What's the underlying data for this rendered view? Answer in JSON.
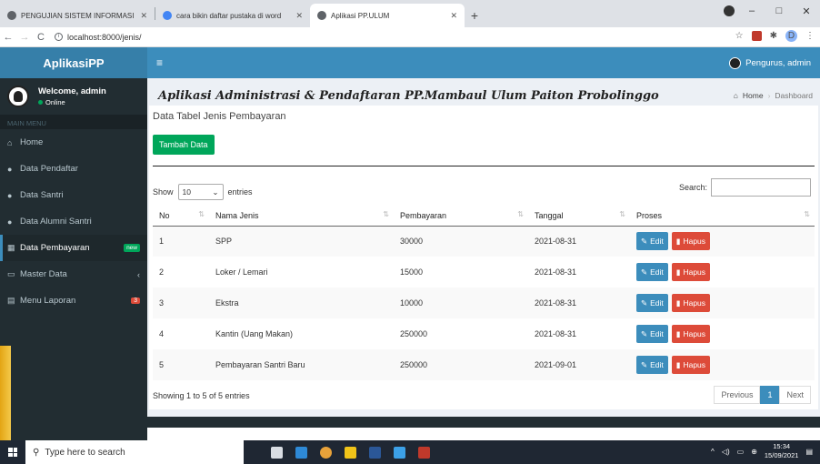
{
  "browser": {
    "tabs": [
      {
        "title": "PENGUJIAN SISTEM INFORMASI",
        "active": false
      },
      {
        "title": "cara bikin daftar pustaka di word",
        "active": false
      },
      {
        "title": "Aplikasi PP.ULUM",
        "active": true
      }
    ],
    "url": "localhost:8000/jenis/",
    "new_tab": "+",
    "win_min": "–",
    "win_max": "□",
    "win_close": "✕",
    "profile_initial": "D"
  },
  "header": {
    "logo": "AplikasiPP",
    "hamburger": "≡",
    "user_label": "Pengurus, admin"
  },
  "sidebar": {
    "welcome": "Welcome, admin",
    "status": "Online",
    "menu_header": "MAIN MENU",
    "items": [
      {
        "label": "Home",
        "icon": "home-icon"
      },
      {
        "label": "Data Pendaftar",
        "icon": "user-icon"
      },
      {
        "label": "Data Santri",
        "icon": "user-icon"
      },
      {
        "label": "Data Alumni Santri",
        "icon": "user-icon"
      },
      {
        "label": "Data Pembayaran",
        "icon": "table-icon",
        "badge": "new"
      },
      {
        "label": "Master Data",
        "icon": "laptop-icon",
        "caret": "‹"
      },
      {
        "label": "Menu Laporan",
        "icon": "calendar-icon",
        "badge": "3"
      }
    ]
  },
  "content": {
    "heading": "Aplikasi Administrasi & Pendaftaran PP.Mambaul Ulum Paiton Probolinggo",
    "breadcrumb": {
      "home": "Home",
      "current": "Dashboard"
    },
    "box_title": "Data Tabel Jenis Pembayaran",
    "add_button": "Tambah Data",
    "show_label": "Show",
    "entries_value": "10",
    "entries_label": "entries",
    "search_label": "Search:",
    "columns": [
      "No",
      "Nama Jenis",
      "Pembayaran",
      "Tanggal",
      "Proses"
    ],
    "rows": [
      {
        "no": "1",
        "nama": "SPP",
        "pembayaran": "30000",
        "tanggal": "2021-08-31"
      },
      {
        "no": "2",
        "nama": "Loker / Lemari",
        "pembayaran": "15000",
        "tanggal": "2021-08-31"
      },
      {
        "no": "3",
        "nama": "Ekstra",
        "pembayaran": "10000",
        "tanggal": "2021-08-31"
      },
      {
        "no": "4",
        "nama": "Kantin (Uang Makan)",
        "pembayaran": "250000",
        "tanggal": "2021-08-31"
      },
      {
        "no": "5",
        "nama": "Pembayaran Santri Baru",
        "pembayaran": "250000",
        "tanggal": "2021-09-01"
      }
    ],
    "edit_label": "Edit",
    "delete_label": "Hapus",
    "info": "Showing 1 to 5 of 5 entries",
    "pager": {
      "previous": "Previous",
      "current": "1",
      "next": "Next"
    }
  },
  "taskbar": {
    "search_placeholder": "Type here to search",
    "time": "15:34",
    "date": "15/09/2021"
  },
  "colors": {
    "primary": "#3c8dbc",
    "success": "#00a65a",
    "danger": "#dd4b39",
    "sidebar": "#222d32"
  }
}
